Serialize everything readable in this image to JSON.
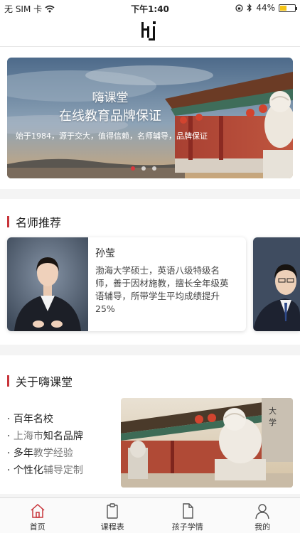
{
  "status": {
    "carrier": "无 SIM 卡",
    "time": "下午1:40",
    "battery": "44%",
    "battery_level": 0.44
  },
  "banner": {
    "title": "嗨课堂",
    "subtitle": "在线教育品牌保证",
    "desc": "始于1984，源于交大，值得信赖，名师辅导，品牌保证",
    "active_dot": 0
  },
  "teachers": {
    "title": "名师推荐",
    "items": [
      {
        "name": "孙莹",
        "desc": "渤海大学硕士，英语八级特级名师，善于因材施教，擅长全年级英语辅导，所带学生平均成绩提升25%"
      }
    ]
  },
  "about": {
    "title": "关于嗨课堂",
    "items": [
      {
        "dot": "· ",
        "bold": "百年名校",
        "rest": ""
      },
      {
        "dot": "· ",
        "pre": "上海市",
        "bold": "知名品牌",
        "rest": ""
      },
      {
        "dot": "· ",
        "bold": "多年",
        "rest": "教学经验"
      },
      {
        "dot": "· ",
        "bold": "个性化",
        "rest": "辅导定制"
      }
    ]
  },
  "tabbar": [
    {
      "label": "首页",
      "icon": "home-icon",
      "active": true
    },
    {
      "label": "课程表",
      "icon": "clipboard-icon",
      "active": false
    },
    {
      "label": "孩子学情",
      "icon": "document-icon",
      "active": false
    },
    {
      "label": "我的",
      "icon": "person-icon",
      "active": false
    }
  ],
  "colors": {
    "accent": "#c8343a",
    "active_tab": "#c8343a"
  }
}
